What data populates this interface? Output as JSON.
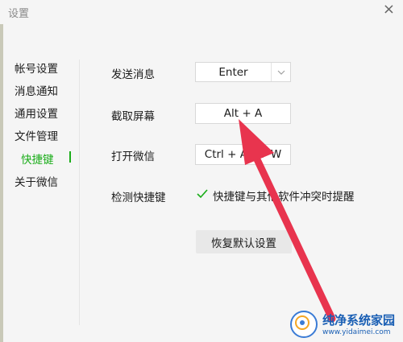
{
  "window": {
    "title": "设置",
    "close_glyph": "×"
  },
  "sidebar": {
    "items": [
      {
        "label": "帐号设置"
      },
      {
        "label": "消息通知"
      },
      {
        "label": "通用设置"
      },
      {
        "label": "文件管理"
      },
      {
        "label": "快捷键"
      },
      {
        "label": "关于微信"
      }
    ],
    "active_index": 4
  },
  "shortcuts": {
    "send_message": {
      "label": "发送消息",
      "value": "Enter"
    },
    "screenshot": {
      "label": "截取屏幕",
      "value": "Alt + A"
    },
    "open_wechat": {
      "label": "打开微信",
      "value": "Ctrl + Alt + W"
    },
    "detect": {
      "label": "检测快捷键",
      "checkbox_label": "快捷键与其他软件冲突时提醒",
      "checked": true
    }
  },
  "reset_button": {
    "label": "恢复默认设置"
  },
  "watermark": {
    "name": "纯净系统家园",
    "url": "www.yidaimei.com"
  },
  "colors": {
    "accent": "#1aad19",
    "arrow": "#e8344e",
    "text": "#1c1c1c",
    "background": "#f5f5f5"
  }
}
